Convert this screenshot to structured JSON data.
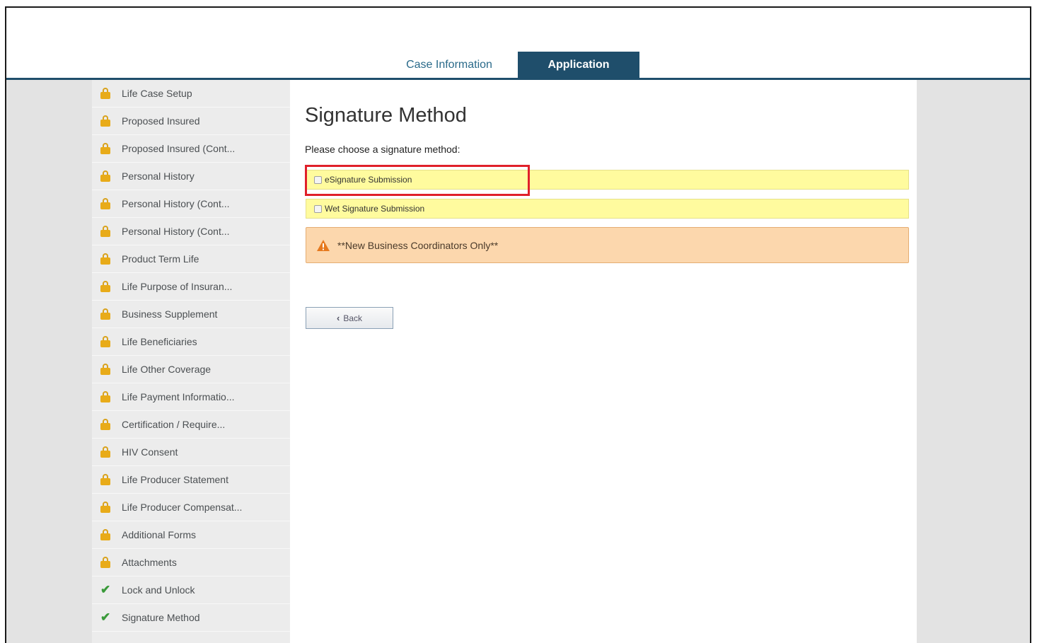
{
  "tabs": [
    {
      "label": "Case Information",
      "active": false
    },
    {
      "label": "Application",
      "active": true
    }
  ],
  "sidebar": {
    "items": [
      {
        "label": "Life Case Setup",
        "icon": "lock-icon"
      },
      {
        "label": "Proposed Insured",
        "icon": "lock-icon"
      },
      {
        "label": "Proposed Insured (Cont...",
        "icon": "lock-icon"
      },
      {
        "label": "Personal History",
        "icon": "lock-icon"
      },
      {
        "label": "Personal History (Cont...",
        "icon": "lock-icon"
      },
      {
        "label": "Personal History (Cont...",
        "icon": "lock-icon"
      },
      {
        "label": "Product Term Life",
        "icon": "lock-icon"
      },
      {
        "label": "Life Purpose of Insuran...",
        "icon": "lock-icon"
      },
      {
        "label": "Business Supplement",
        "icon": "lock-icon"
      },
      {
        "label": "Life Beneficiaries",
        "icon": "lock-icon"
      },
      {
        "label": "Life Other Coverage",
        "icon": "lock-icon"
      },
      {
        "label": "Life Payment Informatio...",
        "icon": "lock-icon"
      },
      {
        "label": "Certification / Require...",
        "icon": "lock-icon"
      },
      {
        "label": "HIV Consent",
        "icon": "lock-icon"
      },
      {
        "label": "Life Producer Statement",
        "icon": "lock-icon"
      },
      {
        "label": "Life Producer Compensat...",
        "icon": "lock-icon"
      },
      {
        "label": "Additional Forms",
        "icon": "lock-icon"
      },
      {
        "label": "Attachments",
        "icon": "lock-icon"
      },
      {
        "label": "Lock and Unlock",
        "icon": "check-icon"
      },
      {
        "label": "Signature Method",
        "icon": "check-icon"
      }
    ]
  },
  "main": {
    "title": "Signature Method",
    "prompt": "Please choose a signature method:",
    "options": [
      {
        "label": "eSignature Submission",
        "checked": false
      },
      {
        "label": "Wet Signature Submission",
        "checked": false
      }
    ],
    "alert": "**New Business Coordinators Only**",
    "back_label": "Back"
  },
  "colors": {
    "tab_active_bg": "#1f4e6b",
    "option_bg": "#fffb9e",
    "alert_bg": "#fcd7ad",
    "highlight": "#e0202a",
    "lock": "#e8ab19",
    "check": "#3a9a3a"
  }
}
